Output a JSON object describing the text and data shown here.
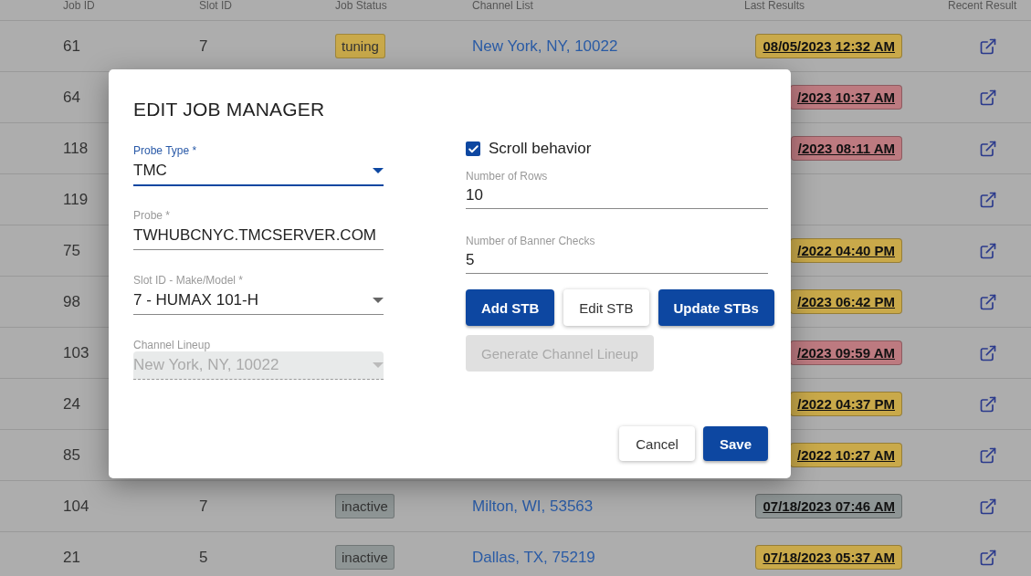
{
  "table": {
    "columns": [
      "Job ID",
      "Slot ID",
      "Job Status",
      "Channel List",
      "Last Results",
      "Recent Result"
    ],
    "rows": [
      {
        "job_id": "61",
        "slot_id": "7",
        "status": {
          "label": "tuning",
          "color": "#c9a94a"
        },
        "channel": "New York, NY, 10022",
        "last_result": {
          "label": "08/05/2023 12:32 AM",
          "color": "#c9a94a"
        }
      },
      {
        "job_id": "64",
        "last_result": {
          "label": "/2023 10:37 AM",
          "color": "#bd7a80"
        }
      },
      {
        "job_id": "118",
        "last_result": {
          "label": "/2023 08:11 AM",
          "color": "#bd7a80"
        }
      },
      {
        "job_id": "119"
      },
      {
        "job_id": "75",
        "last_result": {
          "label": "/2022 04:40 PM",
          "color": "#c9a94a"
        }
      },
      {
        "job_id": "98",
        "last_result": {
          "label": "/2023 06:42 PM",
          "color": "#c9a94a"
        }
      },
      {
        "job_id": "103",
        "last_result": {
          "label": "/2023 09:59 AM",
          "color": "#bd7a80"
        }
      },
      {
        "job_id": "24",
        "last_result": {
          "label": "/2022 04:37 PM",
          "color": "#c9a94a"
        }
      },
      {
        "job_id": "85",
        "last_result": {
          "label": "/2022 10:27 AM",
          "color": "#c9a94a"
        }
      },
      {
        "job_id": "104",
        "slot_id": "7",
        "status": {
          "label": "inactive",
          "color": "#8e9595"
        },
        "channel": "Milton, WI, 53563",
        "last_result": {
          "label": "07/18/2023 07:46 AM",
          "color": "#8e9595"
        }
      },
      {
        "job_id": "21",
        "slot_id": "5",
        "status": {
          "label": "inactive",
          "color": "#8e9595"
        },
        "channel": "Dallas, TX, 75219",
        "last_result": {
          "label": "07/18/2023 05:37 AM",
          "color": "#c9a94a"
        }
      }
    ]
  },
  "dialog": {
    "title": "EDIT JOB MANAGER",
    "fields": [
      {
        "kind": "select",
        "label": "Probe Type *",
        "value": "TMC",
        "focused": true,
        "disabled": false
      },
      {
        "kind": "text",
        "label": "Probe *",
        "value": "TWHUBCNYC.TMCSERVER.COM",
        "focused": false,
        "disabled": false
      },
      {
        "kind": "select",
        "label": "Slot ID - Make/Model *",
        "value": "7 - HUMAX 101-H",
        "focused": false,
        "disabled": false
      },
      {
        "kind": "select",
        "label": "Channel Lineup",
        "value": "New York, NY, 10022",
        "focused": false,
        "disabled": true
      }
    ],
    "scroll_behavior": {
      "label": "Scroll behavior",
      "checked": true
    },
    "settings": [
      {
        "label": "Number of Rows",
        "value": "10"
      },
      {
        "label": "Number of Banner Checks",
        "value": "5"
      }
    ],
    "buttons": [
      {
        "label": "Add STB",
        "kind": "primary"
      },
      {
        "label": "Edit STB",
        "kind": "outlined"
      },
      {
        "label": "Update STBs",
        "kind": "primary"
      },
      {
        "label": "Generate Channel Lineup",
        "kind": "disabled"
      }
    ],
    "footer_buttons": [
      {
        "label": "Cancel",
        "kind": "outlined"
      },
      {
        "label": "Save",
        "kind": "primary"
      }
    ]
  }
}
